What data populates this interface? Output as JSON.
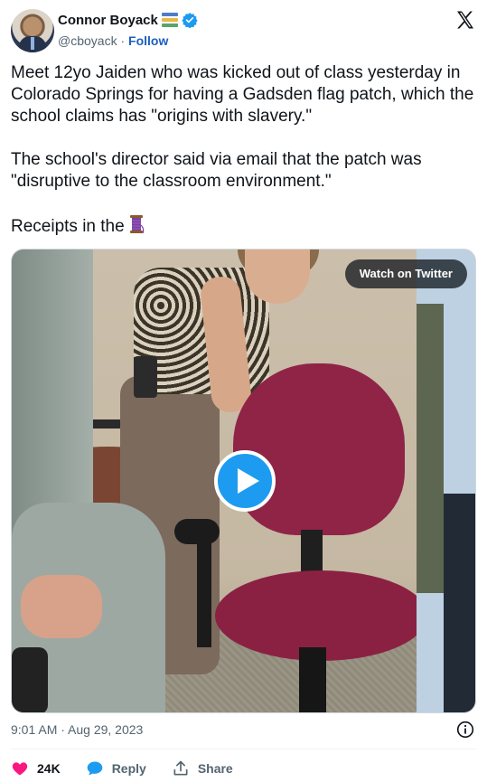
{
  "author": {
    "name": "Connor Boyack",
    "handle": "@cboyack",
    "separator": "·",
    "follow_label": "Follow"
  },
  "tweet": {
    "text": "Meet 12yo Jaiden who was kicked out of class yesterday in Colorado Springs for having a Gadsden flag patch, which the school claims has \"origins with slavery.\"\n\nThe school's director said via email that the patch was \"disruptive to the classroom environment.\"\n\nReceipts in the"
  },
  "media": {
    "watch_label": "Watch on Twitter",
    "play_icon": "play-icon"
  },
  "meta": {
    "timestamp": "9:01 AM · Aug 29, 2023"
  },
  "actions": {
    "likes_count": "24K",
    "reply_label": "Reply",
    "share_label": "Share"
  },
  "colors": {
    "like": "#f91880",
    "reply": "#1d9bf0",
    "verified": "#1d9bf0",
    "accent": "#1d5fbd",
    "play": "#1d9bf0"
  }
}
